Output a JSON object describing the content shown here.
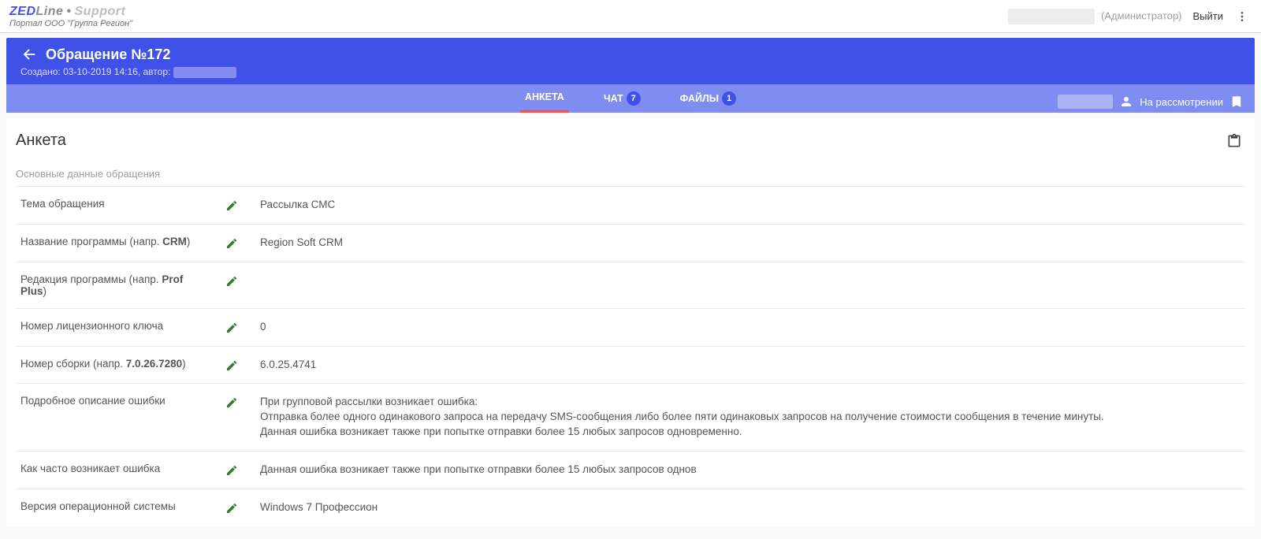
{
  "brand": {
    "part1": "ZED",
    "part2": "Line",
    "part3": "Support",
    "subtitle": "Портал ООО \"Группа Регион\""
  },
  "topbar": {
    "role": "(Администратор)",
    "logout": "Выйти"
  },
  "ticket": {
    "title": "Обращение №172",
    "meta_prefix": "Создано: 03-10-2019 14:16, автор:",
    "status": "На рассмотрении"
  },
  "tabs": {
    "form": "АНКЕТА",
    "chat": "ЧАТ",
    "chat_badge": "7",
    "files": "ФАЙЛЫ",
    "files_badge": "1"
  },
  "card": {
    "title": "Анкета",
    "section": "Основные данные обращения"
  },
  "rows": [
    {
      "label": "Тема обращения",
      "bold": "",
      "value": "Рассылка СМС"
    },
    {
      "label": "Название программы (напр. ",
      "bold": "CRM",
      "suffix": ")",
      "value": "Region Soft CRM"
    },
    {
      "label": "Редакция программы (напр. ",
      "bold": "Prof Plus",
      "suffix": ")",
      "value": ""
    },
    {
      "label": "Номер лицензионного ключа",
      "bold": "",
      "value": "0"
    },
    {
      "label": "Номер сборки (напр. ",
      "bold": "7.0.26.7280",
      "suffix": ")",
      "value": "6.0.25.4741"
    },
    {
      "label": "Подробное описание ошибки",
      "bold": "",
      "value": "При групповой рассылки возникает ошибка:\nОтправка более одного одинакового запроса на передачу SMS-сообщения либо более пяти одинаковых запросов на получение стоимости сообщения в течение минуты.\nДанная ошибка возникает также при попытке отправки более 15 любых запросов одновременно."
    },
    {
      "label": "Как часто возникает ошибка",
      "bold": "",
      "value": "Данная ошибка возникает также при попытке отправки более 15 любых запросов однов"
    },
    {
      "label": "Версия операционной системы",
      "bold": "",
      "value": "Windows 7 Профессион"
    }
  ]
}
